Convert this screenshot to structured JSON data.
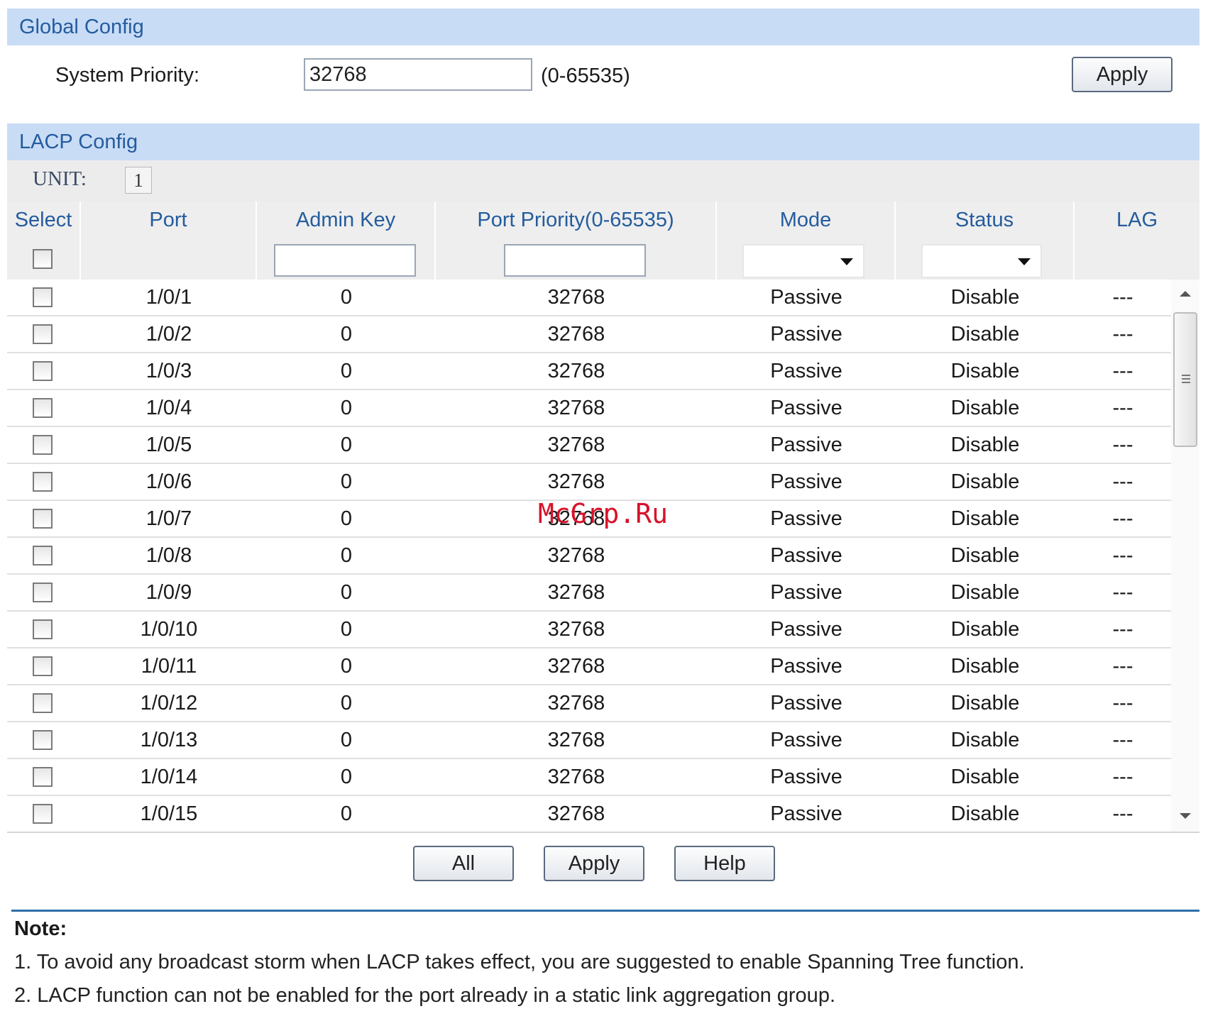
{
  "global_config": {
    "title": "Global Config",
    "system_priority_label": "System Priority:",
    "system_priority_value": "32768",
    "range_hint": "(0-65535)",
    "apply_label": "Apply"
  },
  "lacp_config": {
    "title": "LACP Config",
    "unit_label": "UNIT:",
    "unit_value": "1",
    "columns": [
      "Select",
      "Port",
      "Admin Key",
      "Port Priority(0-65535)",
      "Mode",
      "Status",
      "LAG"
    ],
    "rows": [
      {
        "port": "1/0/1",
        "admin_key": "0",
        "priority": "32768",
        "mode": "Passive",
        "status": "Disable",
        "lag": "---"
      },
      {
        "port": "1/0/2",
        "admin_key": "0",
        "priority": "32768",
        "mode": "Passive",
        "status": "Disable",
        "lag": "---"
      },
      {
        "port": "1/0/3",
        "admin_key": "0",
        "priority": "32768",
        "mode": "Passive",
        "status": "Disable",
        "lag": "---"
      },
      {
        "port": "1/0/4",
        "admin_key": "0",
        "priority": "32768",
        "mode": "Passive",
        "status": "Disable",
        "lag": "---"
      },
      {
        "port": "1/0/5",
        "admin_key": "0",
        "priority": "32768",
        "mode": "Passive",
        "status": "Disable",
        "lag": "---"
      },
      {
        "port": "1/0/6",
        "admin_key": "0",
        "priority": "32768",
        "mode": "Passive",
        "status": "Disable",
        "lag": "---"
      },
      {
        "port": "1/0/7",
        "admin_key": "0",
        "priority": "32768",
        "mode": "Passive",
        "status": "Disable",
        "lag": "---"
      },
      {
        "port": "1/0/8",
        "admin_key": "0",
        "priority": "32768",
        "mode": "Passive",
        "status": "Disable",
        "lag": "---"
      },
      {
        "port": "1/0/9",
        "admin_key": "0",
        "priority": "32768",
        "mode": "Passive",
        "status": "Disable",
        "lag": "---"
      },
      {
        "port": "1/0/10",
        "admin_key": "0",
        "priority": "32768",
        "mode": "Passive",
        "status": "Disable",
        "lag": "---"
      },
      {
        "port": "1/0/11",
        "admin_key": "0",
        "priority": "32768",
        "mode": "Passive",
        "status": "Disable",
        "lag": "---"
      },
      {
        "port": "1/0/12",
        "admin_key": "0",
        "priority": "32768",
        "mode": "Passive",
        "status": "Disable",
        "lag": "---"
      },
      {
        "port": "1/0/13",
        "admin_key": "0",
        "priority": "32768",
        "mode": "Passive",
        "status": "Disable",
        "lag": "---"
      },
      {
        "port": "1/0/14",
        "admin_key": "0",
        "priority": "32768",
        "mode": "Passive",
        "status": "Disable",
        "lag": "---"
      },
      {
        "port": "1/0/15",
        "admin_key": "0",
        "priority": "32768",
        "mode": "Passive",
        "status": "Disable",
        "lag": "---"
      }
    ]
  },
  "buttons": {
    "all": "All",
    "apply": "Apply",
    "help": "Help"
  },
  "note": {
    "title": "Note:",
    "items": [
      "1. To avoid any broadcast storm when LACP takes effect, you are suggested to enable Spanning Tree function.",
      "2. LACP function can not be enabled for the port already in a static link aggregation group."
    ]
  },
  "watermark": "McGrp.Ru",
  "colors": {
    "section_header_bg": "#c9dcf6",
    "section_header_text": "#245c9e",
    "note_rule": "#2f6fab",
    "watermark": "#d8122b"
  }
}
